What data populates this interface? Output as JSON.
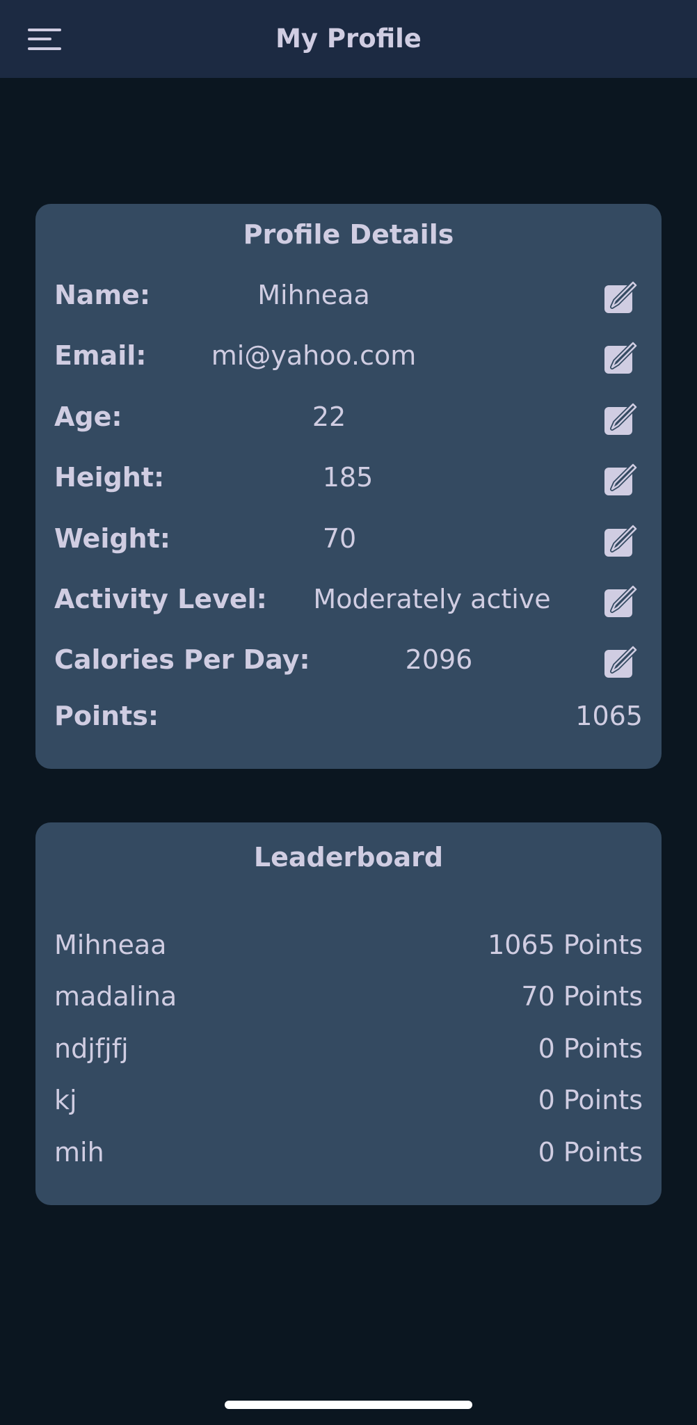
{
  "header": {
    "title": "My Profile",
    "menu_icon": "hamburger-menu-icon"
  },
  "profile": {
    "title": "Profile Details",
    "edit_icon": "edit-icon",
    "fields": [
      {
        "label": "Name:",
        "value": "Mihneaa"
      },
      {
        "label": "Email:",
        "value": "mi@yahoo.com"
      },
      {
        "label": "Age:",
        "value": "22"
      },
      {
        "label": "Height:",
        "value": "185"
      },
      {
        "label": "Weight:",
        "value": "70"
      },
      {
        "label": "Activity Level:",
        "value": "Moderately active"
      },
      {
        "label": "Calories Per Day:",
        "value": "2096"
      }
    ],
    "points": {
      "label": "Points:",
      "value": "1065"
    }
  },
  "leaderboard": {
    "title": "Leaderboard",
    "rows": [
      {
        "name": "Mihneaa",
        "points": "1065 Points"
      },
      {
        "name": "madalina",
        "points": "70 Points"
      },
      {
        "name": "ndjfjfj",
        "points": "0 Points"
      },
      {
        "name": "kj",
        "points": "0 Points"
      },
      {
        "name": "mih",
        "points": "0 Points"
      }
    ]
  },
  "colors": {
    "background": "#0b1620",
    "header": "#1c2a42",
    "card": "#344a61",
    "text": "#d0cde2"
  }
}
